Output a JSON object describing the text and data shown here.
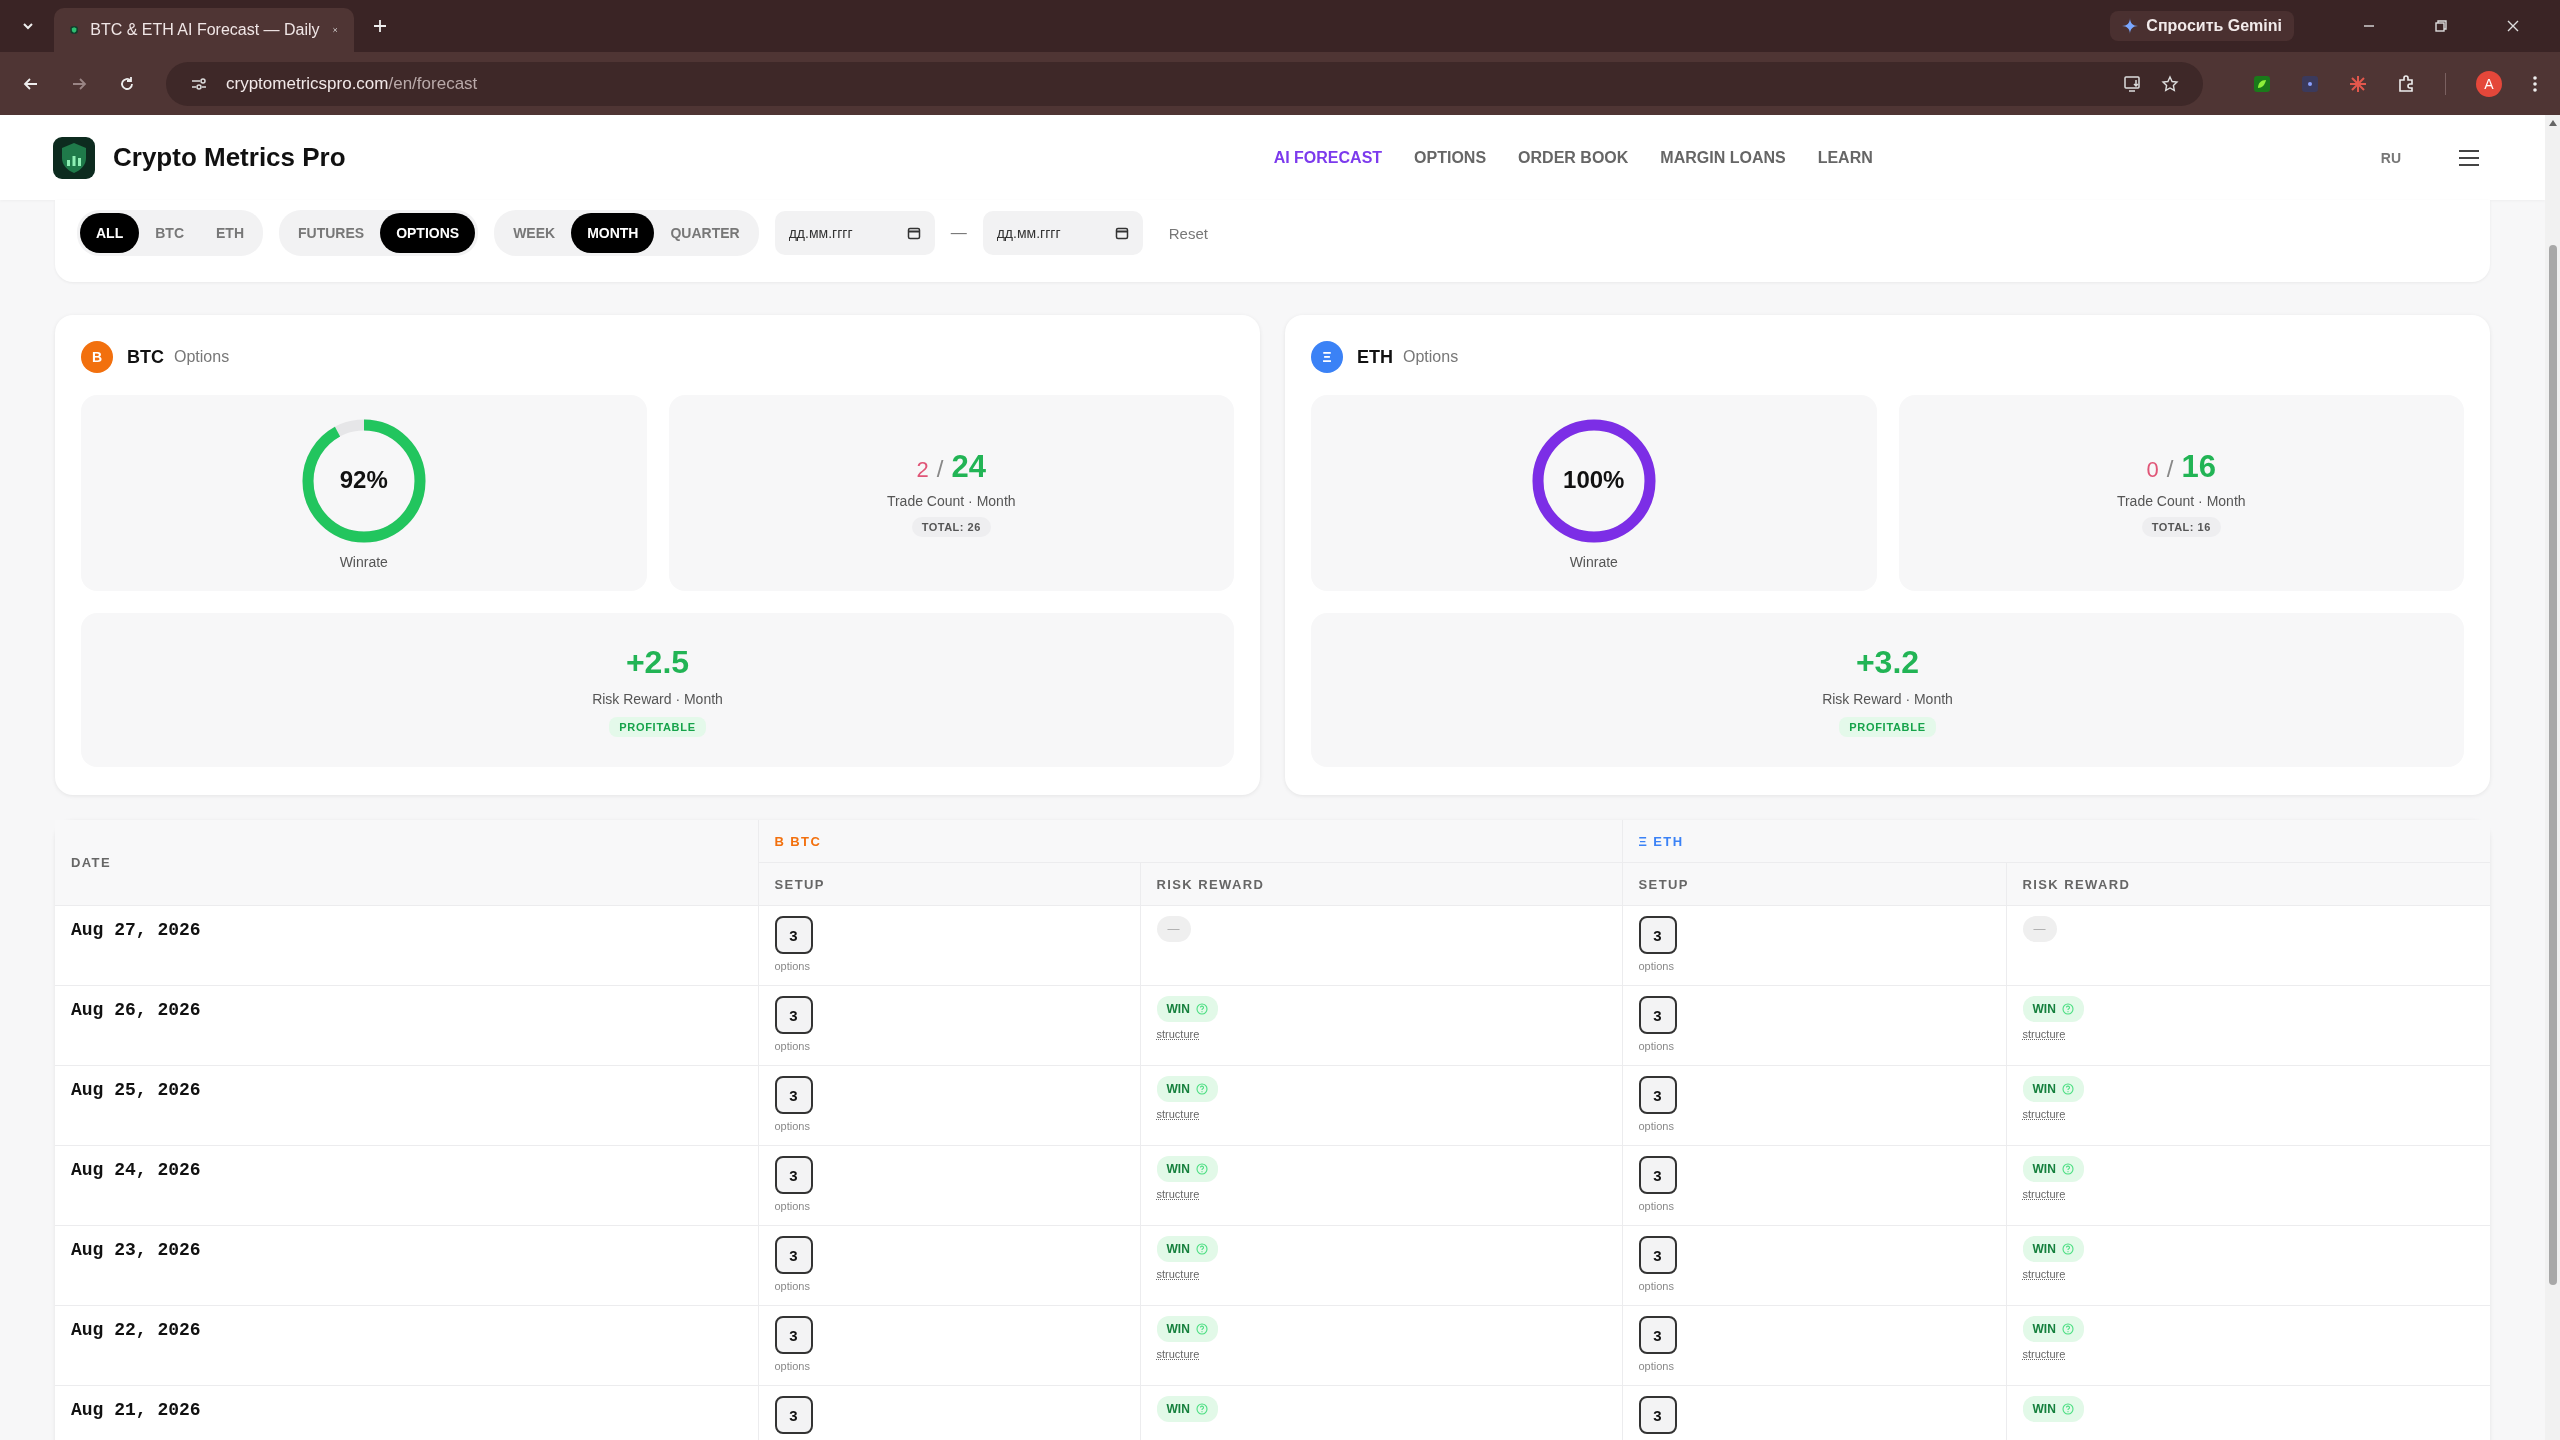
{
  "browser": {
    "tab_title": "BTC & ETH AI Forecast — Daily",
    "url_host": "cryptometricspro.com",
    "url_path": "/en/forecast",
    "gemini": "Спросить Gemini",
    "profile": "A"
  },
  "header": {
    "brand": "Crypto Metrics Pro",
    "nav": [
      {
        "label": "AI FORECAST",
        "selected": true
      },
      {
        "label": "OPTIONS",
        "selected": false
      },
      {
        "label": "ORDER BOOK",
        "selected": false
      },
      {
        "label": "MARGIN LOANS",
        "selected": false
      },
      {
        "label": "LEARN",
        "selected": false
      }
    ],
    "language": "RU"
  },
  "filters": {
    "groups": [
      [
        {
          "label": "ALL",
          "selected": true
        },
        {
          "label": "BTC",
          "selected": false
        },
        {
          "label": "ETH",
          "selected": false
        }
      ],
      [
        {
          "label": "FUTURES",
          "selected": false
        },
        {
          "label": "OPTIONS",
          "selected": true
        }
      ],
      [
        {
          "label": "WEEK",
          "selected": false
        },
        {
          "label": "MONTH",
          "selected": true
        },
        {
          "label": "QUARTER",
          "selected": false
        }
      ]
    ],
    "date_from": {
      "placeholder": "дд.мм.гггг"
    },
    "range_separator": "—",
    "date_to": {
      "placeholder": "дд.мм.гггг"
    },
    "reset": "Reset"
  },
  "cards": [
    {
      "symbol": "B",
      "name": "BTC",
      "color": "#f2700e",
      "subtitle": "Options",
      "winrate": {
        "value": "92%",
        "level": 0.92,
        "color": "#22c55e",
        "label": "Winrate"
      },
      "trades": {
        "losses": "2",
        "separator": "/",
        "wins": "24",
        "label": "Trade Count · Month",
        "total": "TOTAL: 26"
      },
      "risk_reward": {
        "value": "+2.5",
        "label": "Risk Reward · Month",
        "badge": "PROFITABLE"
      }
    },
    {
      "symbol": "Ξ",
      "name": "ETH",
      "color": "#3b82f6",
      "subtitle": "Options",
      "winrate": {
        "value": "100%",
        "level": 1,
        "color": "#7c2ee6",
        "label": "Winrate"
      },
      "trades": {
        "losses": "0",
        "separator": "/",
        "wins": "16",
        "label": "Trade Count · Month",
        "total": "TOTAL: 16"
      },
      "risk_reward": {
        "value": "+3.2",
        "label": "Risk Reward · Month",
        "badge": "PROFITABLE"
      }
    }
  ],
  "table": {
    "date_header": "DATE",
    "groups": [
      {
        "symbol": "B",
        "name": "BTC",
        "color": "#f2700e",
        "columns": [
          "SETUP",
          "RISK REWARD"
        ]
      },
      {
        "symbol": "Ξ",
        "name": "ETH",
        "color": "#3b82f6",
        "columns": [
          "SETUP",
          "RISK REWARD"
        ]
      }
    ],
    "rows": [
      {
        "date": "Aug 27, 2026",
        "cells": [
          {
            "setup": "3",
            "setup_note": "options",
            "result": {
              "kind": "pending",
              "label": "—"
            }
          },
          {
            "setup": "3",
            "setup_note": "options",
            "result": {
              "kind": "pending",
              "label": "—"
            }
          }
        ]
      },
      {
        "date": "Aug 26, 2026",
        "cells": [
          {
            "setup": "3",
            "setup_note": "options",
            "result": {
              "kind": "win",
              "label": "WIN",
              "note": "structure"
            }
          },
          {
            "setup": "3",
            "setup_note": "options",
            "result": {
              "kind": "win",
              "label": "WIN",
              "note": "structure"
            }
          }
        ]
      },
      {
        "date": "Aug 25, 2026",
        "cells": [
          {
            "setup": "3",
            "setup_note": "options",
            "result": {
              "kind": "win",
              "label": "WIN",
              "note": "structure"
            }
          },
          {
            "setup": "3",
            "setup_note": "options",
            "result": {
              "kind": "win",
              "label": "WIN",
              "note": "structure"
            }
          }
        ]
      },
      {
        "date": "Aug 24, 2026",
        "cells": [
          {
            "setup": "3",
            "setup_note": "options",
            "result": {
              "kind": "win",
              "label": "WIN",
              "note": "structure"
            }
          },
          {
            "setup": "3",
            "setup_note": "options",
            "result": {
              "kind": "win",
              "label": "WIN",
              "note": "structure"
            }
          }
        ]
      },
      {
        "date": "Aug 23, 2026",
        "cells": [
          {
            "setup": "3",
            "setup_note": "options",
            "result": {
              "kind": "win",
              "label": "WIN",
              "note": "structure"
            }
          },
          {
            "setup": "3",
            "setup_note": "options",
            "result": {
              "kind": "win",
              "label": "WIN",
              "note": "structure"
            }
          }
        ]
      },
      {
        "date": "Aug 22, 2026",
        "cells": [
          {
            "setup": "3",
            "setup_note": "options",
            "result": {
              "kind": "win",
              "label": "WIN",
              "note": "structure"
            }
          },
          {
            "setup": "3",
            "setup_note": "options",
            "result": {
              "kind": "win",
              "label": "WIN",
              "note": "structure"
            }
          }
        ]
      },
      {
        "date": "Aug 21, 2026",
        "cells": [
          {
            "setup": "3",
            "result": {
              "kind": "win",
              "label": "WIN"
            }
          },
          {
            "setup": "3",
            "result": {
              "kind": "win",
              "label": "WIN"
            }
          }
        ]
      }
    ]
  }
}
